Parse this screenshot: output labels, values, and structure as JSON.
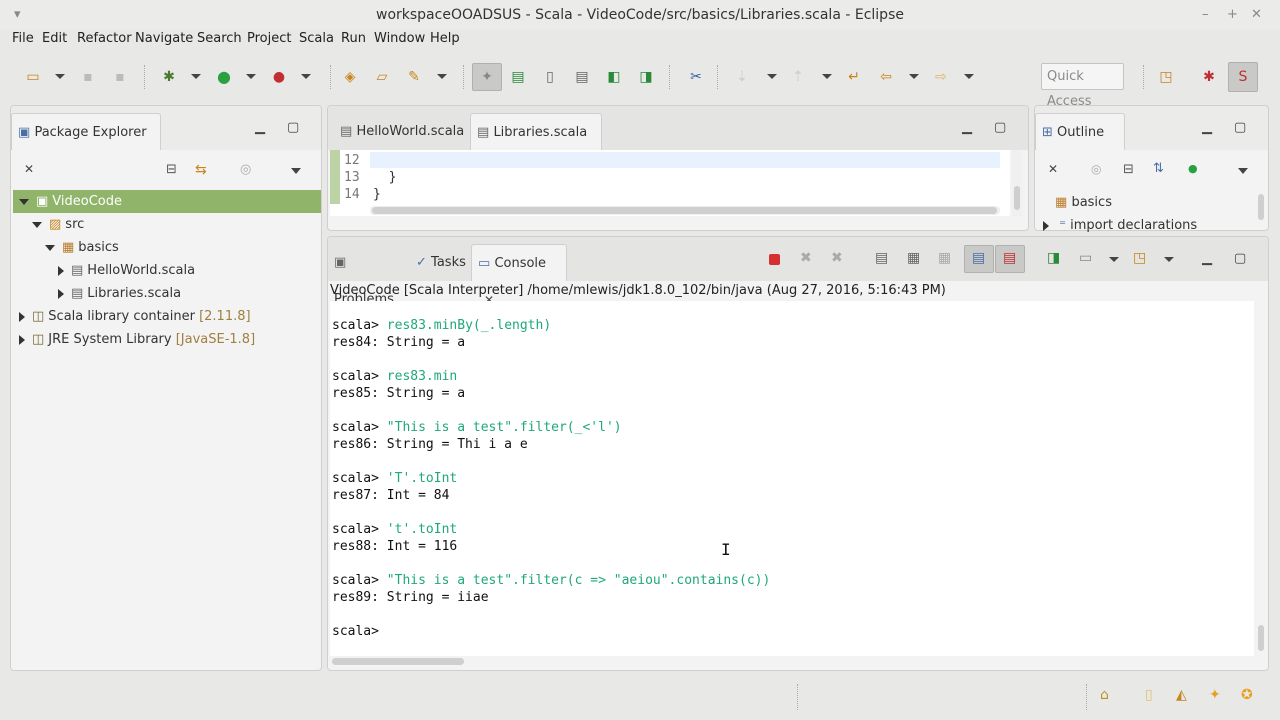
{
  "window": {
    "title": "workspaceOOADSUS - Scala - VideoCode/src/basics/Libraries.scala - Eclipse"
  },
  "menu": [
    "File",
    "Edit",
    "Refactor",
    "Navigate",
    "Search",
    "Project",
    "Scala",
    "Run",
    "Window",
    "Help"
  ],
  "quick_access": {
    "placeholder": "Quick Access"
  },
  "package_explorer": {
    "title": "Package Explorer",
    "tree": [
      {
        "label": "VideoCode",
        "level": 0,
        "expanded": true,
        "icon": "project-icon",
        "selected": true
      },
      {
        "label": "src",
        "level": 1,
        "expanded": true,
        "icon": "source-folder-icon"
      },
      {
        "label": "basics",
        "level": 2,
        "expanded": true,
        "icon": "package-icon"
      },
      {
        "label": "HelloWorld.scala",
        "level": 3,
        "expanded": false,
        "icon": "scala-file-icon"
      },
      {
        "label": "Libraries.scala",
        "level": 3,
        "expanded": false,
        "icon": "scala-file-icon"
      },
      {
        "label": "Scala library container",
        "suffix": "[2.11.8]",
        "level": 0,
        "expanded": false,
        "icon": "library-icon"
      },
      {
        "label": "JRE System Library",
        "suffix": "[JavaSE-1.8]",
        "level": 0,
        "expanded": false,
        "icon": "library-icon"
      }
    ]
  },
  "editor": {
    "tabs": [
      {
        "label": "HelloWorld.scala",
        "active": false
      },
      {
        "label": "Libraries.scala",
        "active": true
      }
    ],
    "lines": [
      {
        "num": "12",
        "text": ""
      },
      {
        "num": "13",
        "text": "  }"
      },
      {
        "num": "14",
        "text": "}"
      }
    ]
  },
  "outline": {
    "title": "Outline",
    "items": [
      {
        "label": "basics",
        "icon": "package-icon"
      },
      {
        "label": "import declarations",
        "icon": "imports-icon"
      }
    ]
  },
  "bottom_tabs": [
    {
      "label": "Problems",
      "active": false
    },
    {
      "label": "Tasks",
      "active": false
    },
    {
      "label": "Console",
      "active": true
    }
  ],
  "console": {
    "header": "VideoCode [Scala Interpreter] /home/mlewis/jdk1.8.0_102/bin/java (Aug 27, 2016, 5:16:43 PM)",
    "lines": [
      {
        "prompt": "scala> ",
        "cmd": "res83.minBy(_.length)"
      },
      {
        "out": "res84: String = a"
      },
      {
        "out": ""
      },
      {
        "prompt": "scala> ",
        "cmd": "res83.min"
      },
      {
        "out": "res85: String = a"
      },
      {
        "out": ""
      },
      {
        "prompt": "scala> ",
        "cmd": "\"This is a test\".filter(_<'l')"
      },
      {
        "out": "res86: String = Thi i a e"
      },
      {
        "out": ""
      },
      {
        "prompt": "scala> ",
        "cmd": "'T'.toInt"
      },
      {
        "out": "res87: Int = 84"
      },
      {
        "out": ""
      },
      {
        "prompt": "scala> ",
        "cmd": "'t'.toInt"
      },
      {
        "out": "res88: Int = 116"
      },
      {
        "out": ""
      },
      {
        "prompt": "scala> ",
        "cmd": "\"This is a test\".filter(c => \"aeiou\".contains(c))"
      },
      {
        "out": "res89: String = iiae"
      },
      {
        "out": ""
      },
      {
        "prompt": "scala> ",
        "cmd": ""
      }
    ]
  },
  "colors": {
    "selection": "#8fb46a",
    "command": "#1fa87a",
    "terminate": "#d62f2f"
  }
}
